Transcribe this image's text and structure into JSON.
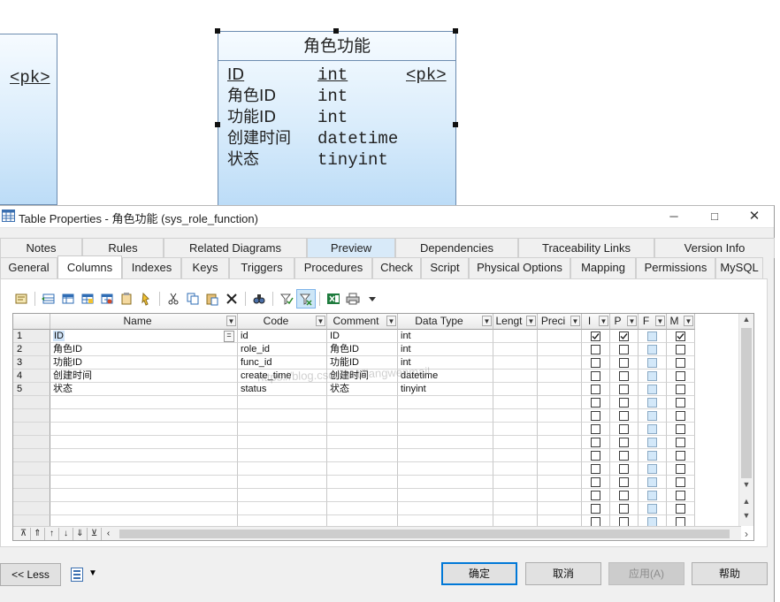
{
  "diagram": {
    "left_entity": {
      "pk_label": "<pk>"
    },
    "entity": {
      "title": "角色功能",
      "rows": [
        {
          "name": "ID",
          "type": "int",
          "key": "<pk>",
          "pk": true
        },
        {
          "name": "角色ID",
          "type": "int",
          "key": "",
          "pk": false
        },
        {
          "name": "功能ID",
          "type": "int",
          "key": "",
          "pk": false
        },
        {
          "name": "创建时间",
          "type": "datetime",
          "key": "",
          "pk": false
        },
        {
          "name": "状态",
          "type": "tinyint",
          "key": "",
          "pk": false
        }
      ]
    }
  },
  "dialog": {
    "title": "Table Properties - 角色功能 (sys_role_function)",
    "window_controls": [
      "minimize-icon",
      "maximize-icon",
      "close-icon"
    ],
    "tabs_back": [
      {
        "label": "Notes",
        "state": "normal"
      },
      {
        "label": "Rules",
        "state": "normal"
      },
      {
        "label": "Related Diagrams",
        "state": "normal"
      },
      {
        "label": "Preview",
        "state": "hover"
      },
      {
        "label": "Dependencies",
        "state": "normal"
      },
      {
        "label": "Traceability Links",
        "state": "normal"
      },
      {
        "label": "Version Info",
        "state": "normal"
      }
    ],
    "tabs_front": [
      {
        "label": "General",
        "state": "normal"
      },
      {
        "label": "Columns",
        "state": "selected"
      },
      {
        "label": "Indexes",
        "state": "normal"
      },
      {
        "label": "Keys",
        "state": "normal"
      },
      {
        "label": "Triggers",
        "state": "normal"
      },
      {
        "label": "Procedures",
        "state": "normal"
      },
      {
        "label": "Check",
        "state": "normal"
      },
      {
        "label": "Script",
        "state": "normal"
      },
      {
        "label": "Physical Options",
        "state": "normal"
      },
      {
        "label": "Mapping",
        "state": "normal"
      },
      {
        "label": "Permissions",
        "state": "normal"
      },
      {
        "label": "MySQL",
        "state": "normal"
      }
    ],
    "toolbar_icons": [
      "properties-icon",
      "separator",
      "insert-row-icon",
      "add-row-icon",
      "add-columns-icon",
      "reuse-columns-icon",
      "paste-rows-icon",
      "find-rows-icon",
      "separator",
      "cut-icon",
      "copy-icon",
      "paste-icon",
      "delete-icon",
      "separator",
      "find-icon",
      "separator",
      "filter-icon",
      "customize-columns-icon",
      "separator",
      "excel-export-icon",
      "print-icon",
      "dropdown-arrow-icon"
    ],
    "grid": {
      "columns": [
        "Name",
        "Code",
        "Comment",
        "Data Type",
        "Lengt",
        "Preci",
        "I",
        "P",
        "F",
        "M"
      ],
      "rows": [
        {
          "num": "1",
          "name": "ID",
          "code": "id",
          "comment": "ID",
          "type": "int",
          "length": "",
          "precision": "",
          "i": true,
          "p": true,
          "f": false,
          "m": true
        },
        {
          "num": "2",
          "name": "角色ID",
          "code": "role_id",
          "comment": "角色ID",
          "type": "int",
          "length": "",
          "precision": "",
          "i": false,
          "p": false,
          "f": false,
          "m": false
        },
        {
          "num": "3",
          "name": "功能ID",
          "code": "func_id",
          "comment": "功能ID",
          "type": "int",
          "length": "",
          "precision": "",
          "i": false,
          "p": false,
          "f": false,
          "m": false
        },
        {
          "num": "4",
          "name": "创建时间",
          "code": "create_time",
          "comment": "创建时间",
          "type": "datetime",
          "length": "",
          "precision": "",
          "i": false,
          "p": false,
          "f": false,
          "m": false
        },
        {
          "num": "5",
          "name": "状态",
          "code": "status",
          "comment": "状态",
          "type": "tinyint",
          "length": "",
          "precision": "",
          "i": false,
          "p": false,
          "f": false,
          "m": false
        }
      ],
      "editing_marker": "="
    },
    "watermark": "https://blog.csdn.net/liangwenmail",
    "footer": {
      "less_label": "<< Less",
      "ok_label": "确定",
      "cancel_label": "取消",
      "apply_label": "应用(A)",
      "help_label": "帮助"
    }
  }
}
